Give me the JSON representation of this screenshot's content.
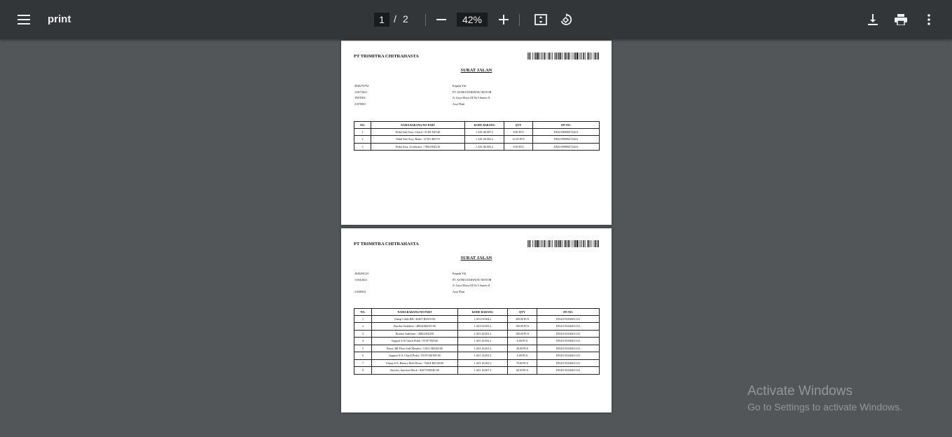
{
  "toolbar": {
    "title": "print",
    "current_page": "1",
    "separator": "/",
    "total_pages": "2",
    "zoom": "42%",
    "icons": {
      "menu": "menu-icon",
      "zoom_out": "minus-icon",
      "zoom_in": "plus-icon",
      "fit": "fit-page-icon",
      "rotate": "rotate-icon",
      "download": "download-icon",
      "print": "print-icon",
      "more": "more-vert-icon"
    }
  },
  "pages": [
    {
      "company": "PT TRIMITRA CHITRAHASTA",
      "title": "SURAT JALAN",
      "meta_left": [
        "4040276794",
        "12/07/2021",
        "TEST002",
        "21070001"
      ],
      "meta_right": [
        "Kepada Yth.",
        "PT. ASTRA DAIHATSU MOTOR",
        "Jl. Gaya Motor III No.5 Sunter II",
        "Assy Plant"
      ],
      "columns": [
        "NO.",
        "NAMA BARANG/NO PART",
        "KODE BARANG",
        "QTY",
        "DN NO."
      ],
      "rows": [
        [
          "1",
          "Pedal Sub-Assy, Clutch / 31301-BZ140",
          "1.A01.06.007.2",
          "8.00 PCS",
          "DN4119090827226A"
        ],
        [
          "2",
          "Pedal Sub-Assy, Brake / 47101-BZ170",
          "1.A01.06.002.2",
          "12.00 PCS",
          "DN4119090827226A"
        ],
        [
          "3",
          "Pedal Assy, Accelerator / 78010-BZ110",
          "1.A01.06.005.2",
          "8.00 PCS",
          "DN4119090827226A"
        ]
      ]
    },
    {
      "company": "PT TRIMITRA CHITRAHASTA",
      "title": "SURAT JALAN",
      "meta_left": [
        "4040260123",
        "13/04/2021",
        "",
        "21040034"
      ],
      "meta_right": [
        "Kepada Yth.",
        "PT. ASTRA DAIHATSU MOTOR",
        "Jl. Gaya Motor III No.5 Sunter II",
        "Assy Plant"
      ],
      "columns": [
        "NO.",
        "NAMA BARANG/NO PART",
        "KODE BARANG",
        "QTY",
        "DN NO."
      ],
      "rows": [
        [
          "1",
          "Clamp Cable RH / 46467-BZ010-00",
          "1.A01.03.004.2",
          "200.00 PCS",
          "DN4119110260111A"
        ],
        [
          "2",
          "Bracket Stabilizer / 48824-BZ010-00",
          "1.A01.03.003.2",
          "100.00 PCS",
          "DN4119110260111A"
        ],
        [
          "3",
          "Bracket Stabilizer / 48824-BZ250",
          "1.A01.20.001.2",
          "100.00 PCS",
          "DN4119110260111A"
        ],
        [
          "4",
          "Support S/A Clutch Pedal / 55107-BZ320",
          "1.A01.20.002.2",
          "6.00 PCS",
          "DN4119110260111A"
        ],
        [
          "5",
          "Brace, RR Floor Side Member / 51651-BZ020-00",
          "1.A01.16.001.2",
          "40.00 PCS",
          "DN4119110260111A"
        ],
        [
          "6",
          "Support S/A, Clutch Pedal / 55107-BZ190-00",
          "1.A01.14.003.2",
          "6.00 PCS",
          "DN4119110260111A"
        ],
        [
          "7",
          "Clamp S/A, Battery Hold Down / 74404-BZ100-00",
          "1.A01.16.005.2",
          "70.00 PCS",
          "DN4119110260111A"
        ],
        [
          "8",
          "Bracket, Junction Block / 82673-BZ040-00",
          "1.A01.16.007.2",
          "60.00 PCS",
          "DN4119110260111A"
        ]
      ]
    }
  ],
  "watermark": {
    "title": "Activate Windows",
    "subtitle": "Go to Settings to activate Windows."
  }
}
